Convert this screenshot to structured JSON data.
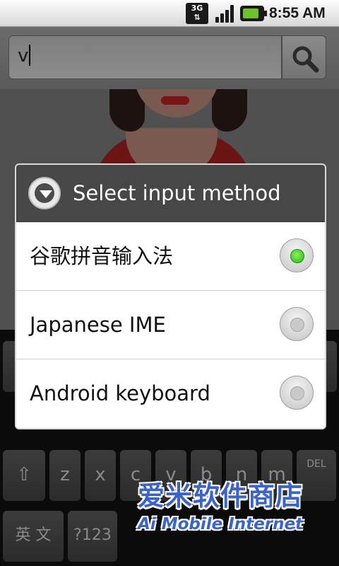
{
  "status_bar": {
    "network": "3G",
    "time": "8:55 AM"
  },
  "search": {
    "value": "v"
  },
  "dialog": {
    "title": "Select input method",
    "options": [
      {
        "label": "谷歌拼音输入法",
        "selected": true
      },
      {
        "label": "Japanese IME",
        "selected": false
      },
      {
        "label": "Android keyboard",
        "selected": false
      }
    ]
  },
  "keyboard": {
    "row3": [
      "z",
      "x",
      "c",
      "v",
      "b",
      "n",
      "m"
    ],
    "del_label": "DEL",
    "lang_label": "英 文",
    "symbols_label": "?123"
  },
  "watermark": {
    "cn": "爱米软件商店",
    "en": "Ai Mobile Internet"
  },
  "colors": {
    "selected_radio": "#21b815",
    "dialog_title_bg": "#474747",
    "watermark_blue": "#3a64c8"
  }
}
